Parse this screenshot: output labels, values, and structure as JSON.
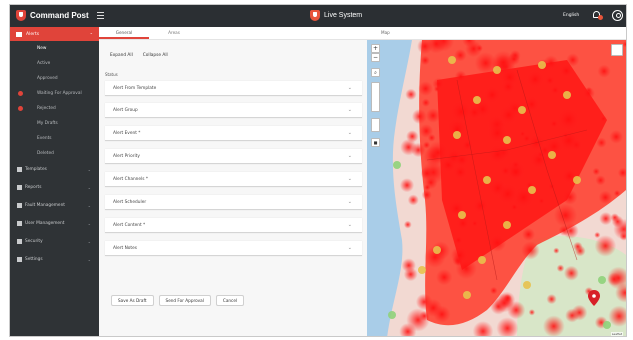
{
  "app": {
    "brand": "Command Post",
    "system_label": "Live System",
    "language": "English"
  },
  "sidebar": {
    "section": "Alerts",
    "sub_items": [
      {
        "label": "New"
      },
      {
        "label": "Active"
      },
      {
        "label": "Approved"
      },
      {
        "label": "Waiting For Approval"
      },
      {
        "label": "Rejected"
      },
      {
        "label": "My Drafts"
      },
      {
        "label": "Events"
      },
      {
        "label": "Deleted"
      }
    ],
    "menu": [
      {
        "label": "Templates"
      },
      {
        "label": "Reports"
      },
      {
        "label": "Fault Management"
      },
      {
        "label": "User Management"
      },
      {
        "label": "Security"
      },
      {
        "label": "Settings"
      }
    ]
  },
  "main": {
    "tabs": [
      {
        "label": "General"
      },
      {
        "label": "Areas"
      }
    ],
    "expand_all": "Expand All",
    "collapse_all": "Collapse All",
    "status_label": "Status",
    "fields": [
      {
        "label": "Alert From Template"
      },
      {
        "label": "Alert Group"
      },
      {
        "label": "Alert Event *"
      },
      {
        "label": "Alert Priority"
      },
      {
        "label": "Alert Channels *"
      },
      {
        "label": "Alert Scheduler"
      },
      {
        "label": "Alert Content *"
      },
      {
        "label": "Alert Notes"
      }
    ],
    "buttons": {
      "save_draft": "Save As Draft",
      "send_approval": "Send For Approval",
      "cancel": "Cancel"
    }
  },
  "map": {
    "tab": "Map",
    "zoom_in": "+",
    "zoom_out": "−",
    "attribution": "Leaflet"
  },
  "colors": {
    "accent": "#e0443a",
    "sidebar": "#2f3336",
    "topbar": "#2b2f33",
    "water": "#a9cde8",
    "heat": "#ff0000"
  }
}
